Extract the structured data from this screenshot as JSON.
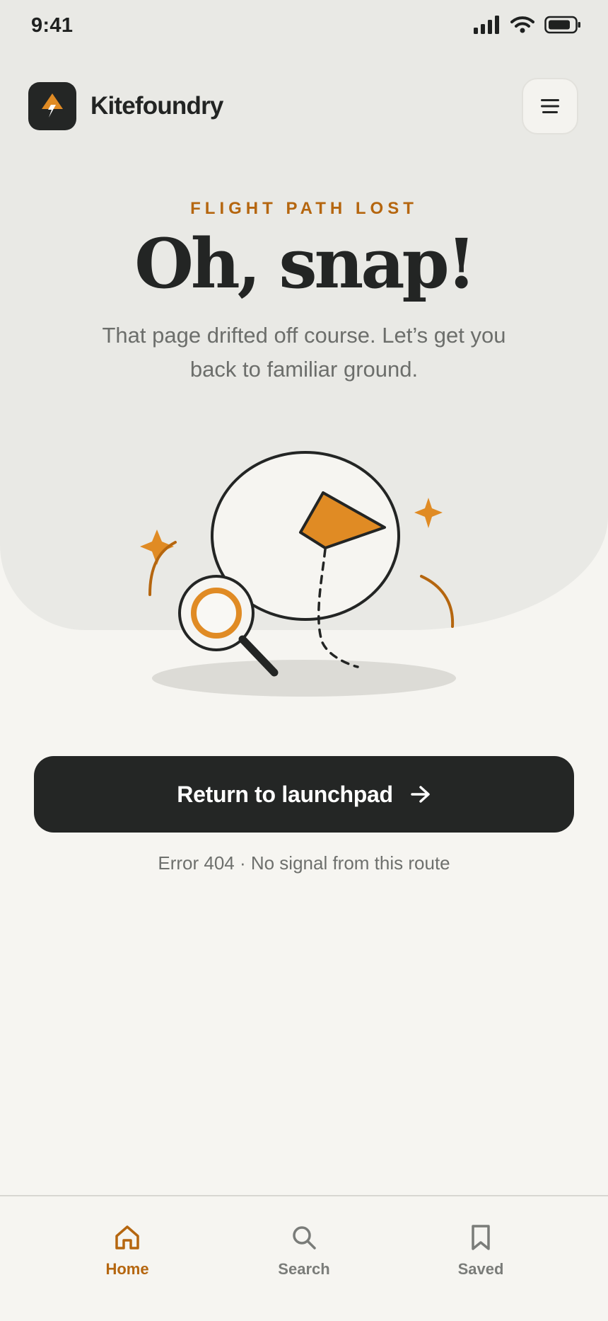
{
  "status_bar": {
    "time": "9:41"
  },
  "header": {
    "brand": "Kitefoundry"
  },
  "hero": {
    "eyebrow": "FLIGHT PATH LOST",
    "headline": "Oh, snap!",
    "subtitle": "That page drifted off course. Let’s get you back to familiar ground."
  },
  "cta": {
    "label": "Return to launchpad"
  },
  "error_note": "Error 404 · No signal from this route",
  "bottom_nav": {
    "items": [
      {
        "label": "Home",
        "icon": "home-icon",
        "active": true
      },
      {
        "label": "Search",
        "icon": "search-icon",
        "active": false
      },
      {
        "label": "Saved",
        "icon": "bookmark-icon",
        "active": false
      }
    ]
  },
  "colors": {
    "accent": "#e08b24",
    "accent_text": "#b5660f",
    "dark": "#242625",
    "background": "#f6f5f1",
    "hero_background": "#e9e9e5"
  }
}
